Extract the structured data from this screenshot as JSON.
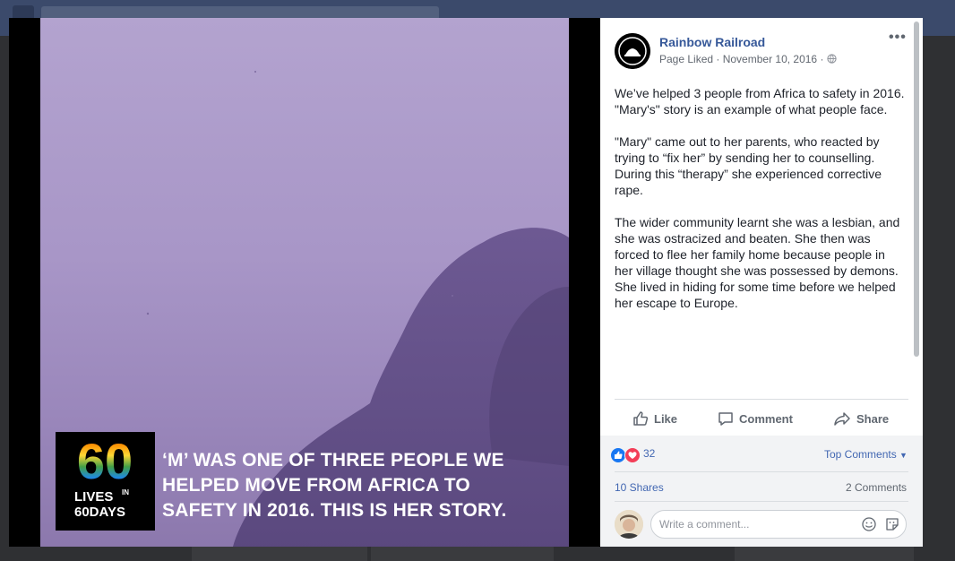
{
  "post": {
    "page_name": "Rainbow Railroad",
    "meta": "Page Liked · November 10, 2016 · ",
    "globe_icon": "globe-icon",
    "paragraphs": [
      "We’ve helped 3 people from Africa to safety in 2016. \"Mary's\" story is an example of what people face.",
      "\"Mary\" came out to her parents, who reacted by trying to “fix her” by sending her to counselling. During this “therapy” she experienced corrective rape.",
      "The wider community learnt she was a lesbian, and she was ostracized and beaten. She then was forced to flee her family home because people in her village thought she was possessed by demons. She lived in hiding for some time before we helped her escape to Europe."
    ]
  },
  "actions": {
    "like": "Like",
    "comment": "Comment",
    "share": "Share"
  },
  "stats": {
    "reactions_count": "32",
    "top_comments": "Top Comments",
    "shares": "10 Shares",
    "comments": "2 Comments"
  },
  "comment_input": {
    "placeholder": "Write a comment..."
  },
  "image": {
    "logo_number": "60",
    "logo_line1": "LIVES",
    "logo_in": "IN",
    "logo_line2": "60DAYS",
    "caption_lines": [
      "‘M’ WAS ONE OF THREE PEOPLE WE",
      "HELPED MOVE FROM AFRICA TO",
      "SAFETY IN 2016. THIS IS HER STORY."
    ]
  },
  "colors": {
    "link": "#365899",
    "accent": "#4267b2",
    "like_reaction": "#1877f2",
    "love_reaction": "#f33e58"
  }
}
